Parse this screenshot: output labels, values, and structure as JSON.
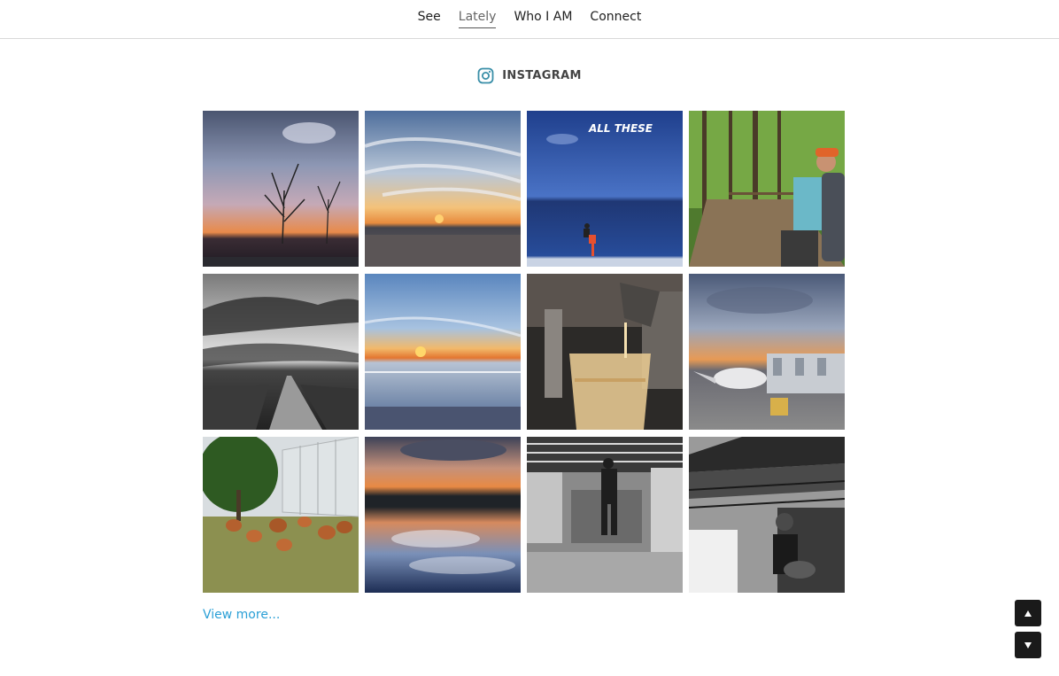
{
  "nav": {
    "items": [
      {
        "label": "See"
      },
      {
        "label": "Lately"
      },
      {
        "label": "Who I AM"
      },
      {
        "label": "Connect"
      }
    ],
    "active": "Lately"
  },
  "section": {
    "title": "INSTAGRAM",
    "icon": "instagram-icon"
  },
  "photos": [
    {
      "subject": "sunset-bare-tree"
    },
    {
      "subject": "sunset-over-bay"
    },
    {
      "subject": "blue-sea-figure",
      "caption": "ALL THESE"
    },
    {
      "subject": "hiker-forest-trail"
    },
    {
      "subject": "bw-jetty-clouds"
    },
    {
      "subject": "sunset-beach"
    },
    {
      "subject": "whiskey-glass-pour"
    },
    {
      "subject": "airport-jet-bridge"
    },
    {
      "subject": "chickens-greenhouse"
    },
    {
      "subject": "sunset-reflection"
    },
    {
      "subject": "bw-brewery-worker"
    },
    {
      "subject": "bw-musician-tent"
    }
  ],
  "view_more": "View more...",
  "scroll": {
    "up_icon": "triangle-up-icon",
    "down_icon": "triangle-down-icon"
  },
  "colors": {
    "link": "#2a9fd6",
    "scroll_button": "#1a1a1a"
  }
}
